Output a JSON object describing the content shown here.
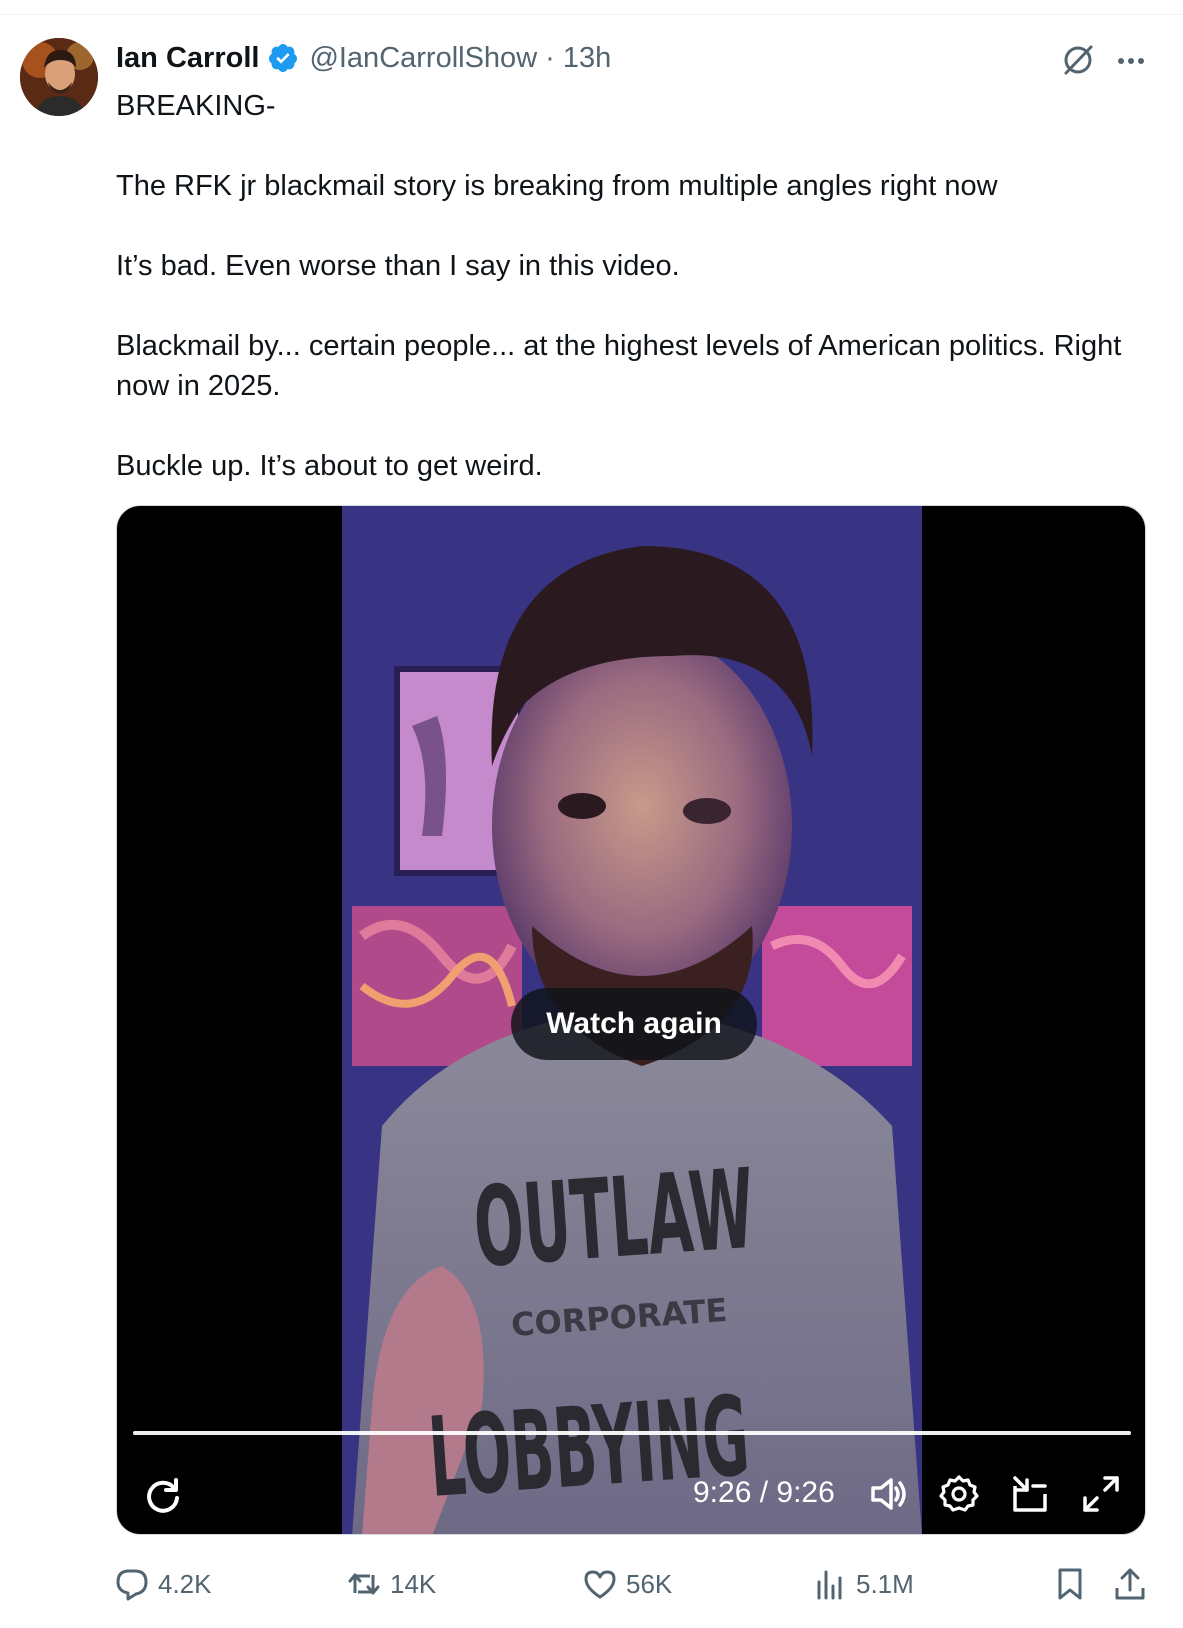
{
  "author": {
    "name": "Ian Carroll",
    "handle": "@IanCarrollShow",
    "separator": "·",
    "time": "13h",
    "verified_color": "#1d9bf0"
  },
  "tweet": {
    "paragraphs": [
      "BREAKING-",
      "The RFK jr blackmail story is breaking from multiple angles right now",
      "It’s bad. Even worse than I say in this video.",
      "Blackmail by... certain people... at the highest levels of American politics. Right now in 2025.",
      "Buckle up. It’s about to get weird."
    ]
  },
  "video": {
    "overlay_button": "Watch again",
    "timecode": "9:26 / 9:26",
    "progress_fraction": 1.0,
    "shirt_text_main": "OUTLAW",
    "shirt_text_sub": "CORPORATE",
    "shirt_text_bottom": "LOBBYING"
  },
  "actions": {
    "replies": "4.2K",
    "reposts": "14K",
    "likes": "56K",
    "views": "5.1M"
  },
  "icons": {
    "reply": "reply-icon",
    "repost": "repost-icon",
    "like": "heart-icon",
    "views": "views-icon",
    "bookmark": "bookmark-icon",
    "share": "share-icon",
    "grok": "grok-icon",
    "more": "more-icon"
  },
  "colors": {
    "text_primary": "#0f1419",
    "text_secondary": "#536471",
    "accent": "#1d9bf0"
  }
}
